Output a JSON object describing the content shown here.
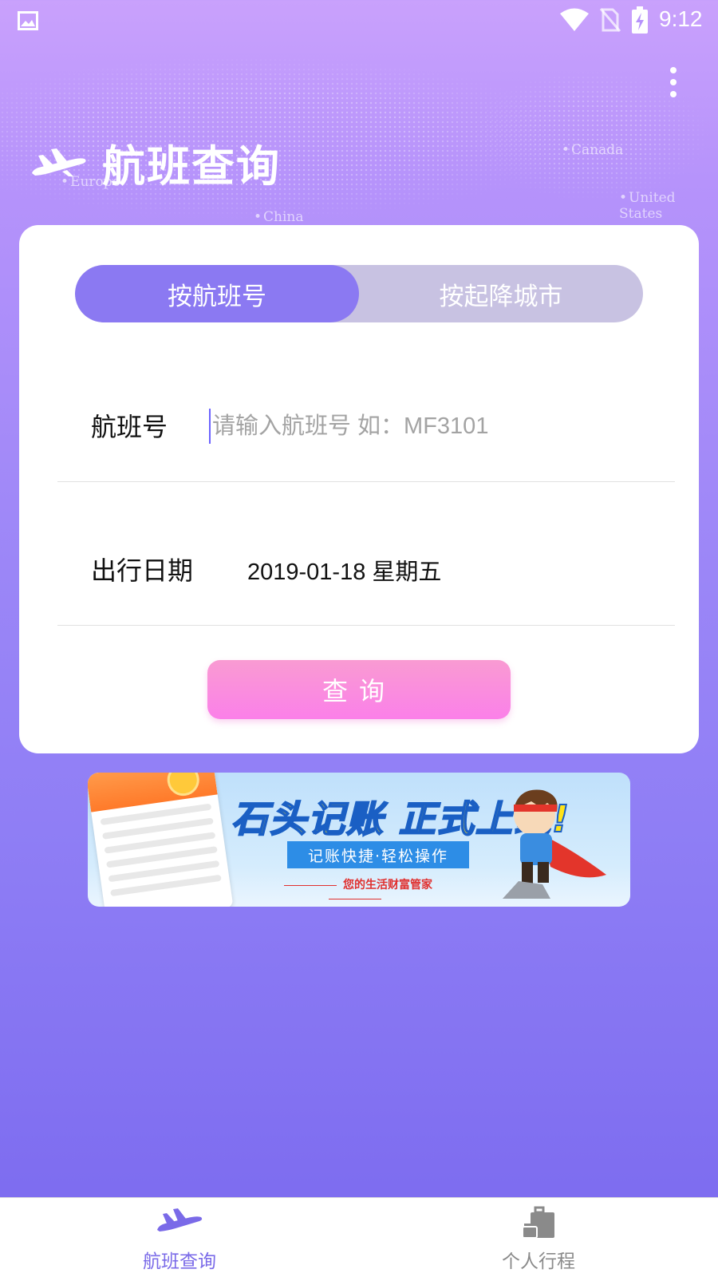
{
  "status_bar": {
    "time": "9:12"
  },
  "map_labels": [
    "Canada",
    "Europe",
    "China",
    "United States"
  ],
  "header": {
    "title": "航班查询"
  },
  "search_tabs": [
    {
      "label": "按航班号",
      "active": true
    },
    {
      "label": "按起降城市",
      "active": false
    }
  ],
  "form": {
    "flight_label": "航班号",
    "flight_placeholder": "请输入航班号 如：MF3101",
    "flight_value": "",
    "date_label": "出行日期",
    "date_value": "2019-01-18 星期五",
    "query_button": "查询"
  },
  "banner": {
    "title": "石头记账 正式上线!",
    "ribbon": "记账快捷·轻松操作",
    "slogan": "您的生活财富管家"
  },
  "bottom_nav": [
    {
      "label": "航班查询",
      "icon": "plane-icon",
      "active": true
    },
    {
      "label": "个人行程",
      "icon": "luggage-icon",
      "active": false
    }
  ],
  "colors": {
    "accent": "#8b79f2",
    "tab_inactive": "#c8c2e2",
    "query_button": "#fb8ede",
    "nav_active": "#7a6ae8"
  }
}
